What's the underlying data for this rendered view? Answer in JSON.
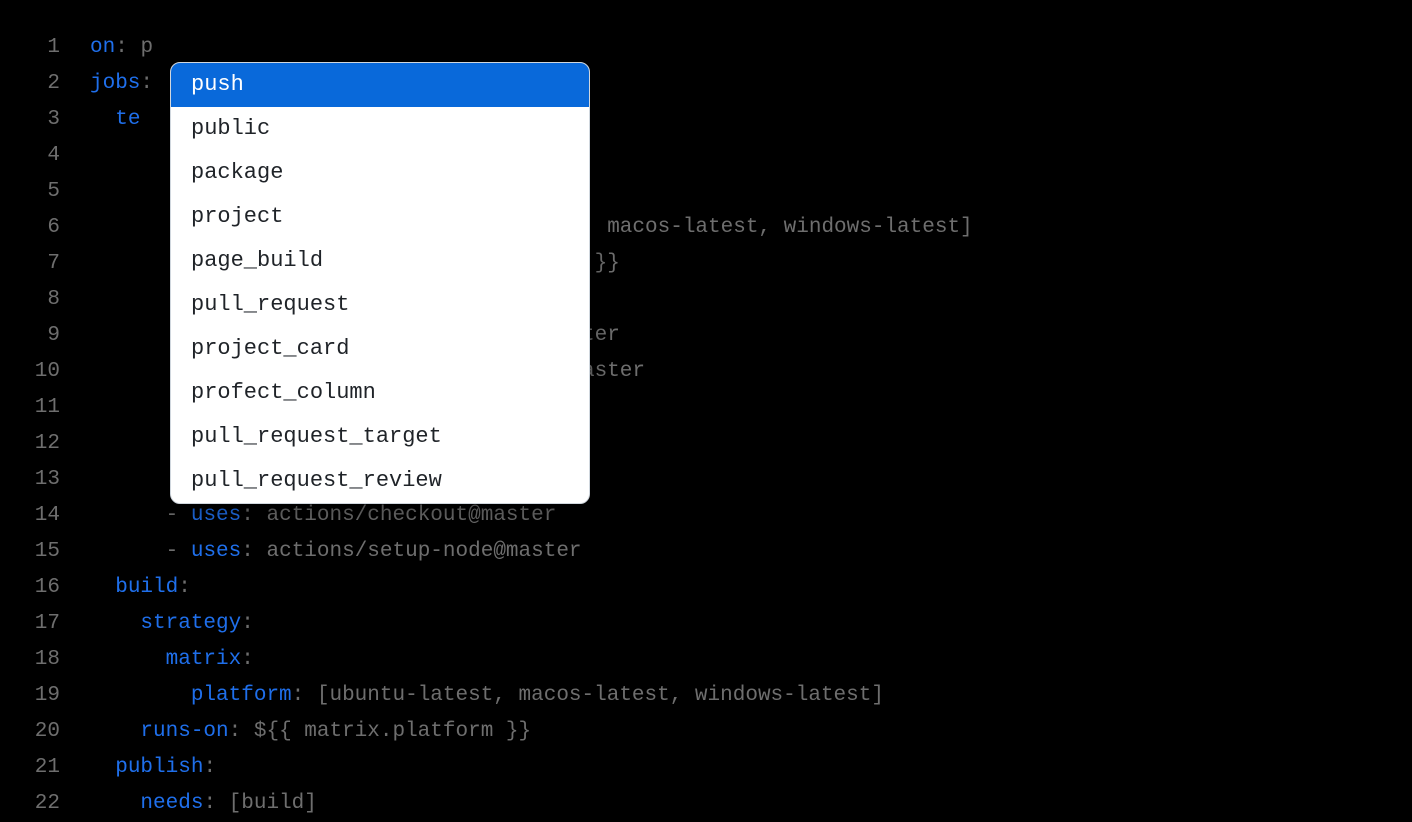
{
  "gutter": {
    "lines": [
      "1",
      "2",
      "3",
      "4",
      "5",
      "6",
      "7",
      "8",
      "9",
      "10",
      "11",
      "12",
      "13",
      "14",
      "15",
      "16",
      "17",
      "18",
      "19",
      "20",
      "21",
      "22"
    ]
  },
  "code": {
    "line1": {
      "key": "on",
      "punct": ": ",
      "value": "p"
    },
    "line2": {
      "key": "jobs",
      "punct": ":"
    },
    "line3": {
      "indent": "  ",
      "key": "te"
    },
    "line6": {
      "value": ", macos-latest, windows-latest]"
    },
    "line7": {
      "value": " }}"
    },
    "line9": {
      "value": "ter"
    },
    "line10": {
      "value": "aster"
    },
    "line14": {
      "indent": "      ",
      "dash": "- ",
      "key": "uses",
      "punct": ": ",
      "value": "actions/checkout@master"
    },
    "line15": {
      "indent": "      ",
      "dash": "- ",
      "key": "uses",
      "punct": ": ",
      "value": "actions/setup-node@master"
    },
    "line16": {
      "indent": "  ",
      "key": "build",
      "punct": ":"
    },
    "line17": {
      "indent": "    ",
      "key": "strategy",
      "punct": ":"
    },
    "line18": {
      "indent": "      ",
      "key": "matrix",
      "punct": ":"
    },
    "line19": {
      "indent": "        ",
      "key": "platform",
      "punct": ": ",
      "value": "[ubuntu-latest, macos-latest, windows-latest]"
    },
    "line20": {
      "indent": "    ",
      "key": "runs-on",
      "punct": ": ",
      "value": "${{ matrix.platform }}"
    },
    "line21": {
      "indent": "  ",
      "key": "publish",
      "punct": ":"
    },
    "line22": {
      "indent": "    ",
      "key": "needs",
      "punct": ": ",
      "value": "[build]"
    }
  },
  "autocomplete": {
    "items": [
      "push",
      "public",
      "package",
      "project",
      "page_build",
      "pull_request",
      "project_card",
      "profect_column",
      "pull_request_target",
      "pull_request_review"
    ]
  }
}
